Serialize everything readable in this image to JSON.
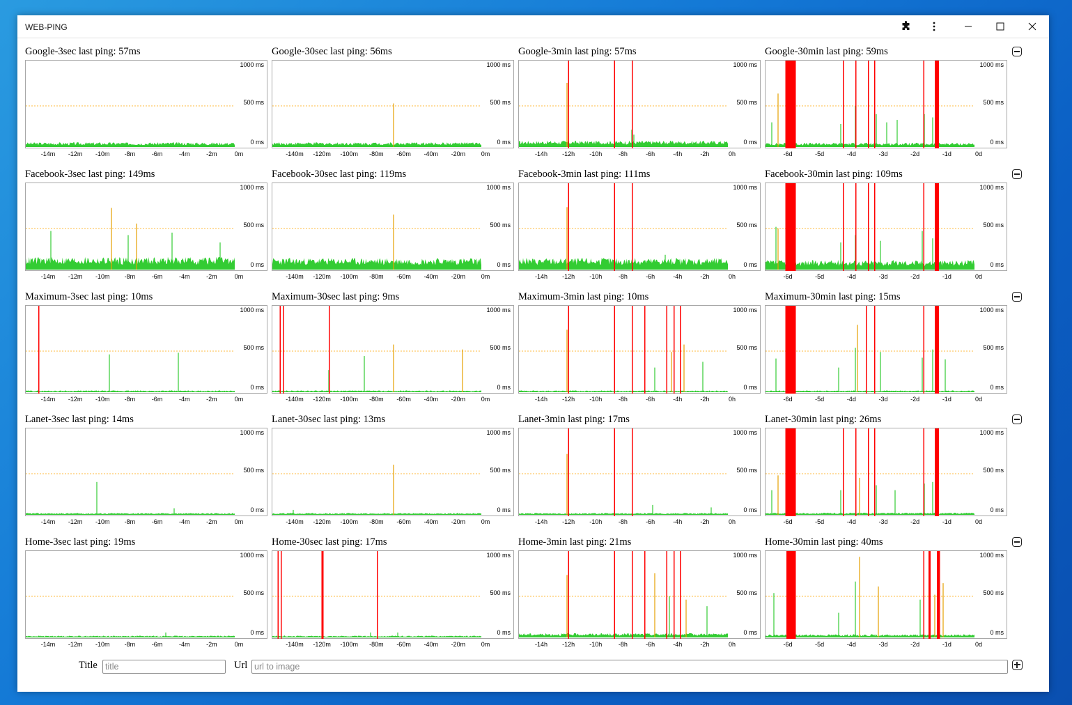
{
  "window": {
    "title": "WEB-PING",
    "controls": {
      "extensions_icon": "puzzle-icon",
      "menu_icon": "kebab-menu-icon",
      "minimize_icon": "minimize-icon",
      "maximize_icon": "maximize-icon",
      "close_icon": "close-icon"
    }
  },
  "colors": {
    "ok": "#33cc33",
    "warn": "#e6a000",
    "fail": "#ff0000",
    "threshold_line": "#ffa500"
  },
  "axis": {
    "y_labels": [
      "1000 ms",
      "500 ms",
      "0 ms"
    ],
    "y_range": [
      0,
      1000
    ],
    "threshold_ms": 500,
    "x_labels": {
      "3sec": [
        "-14m",
        "-12m",
        "-10m",
        "-8m",
        "-6m",
        "-4m",
        "-2m",
        "0m"
      ],
      "30sec": [
        "-140m",
        "-120m",
        "-100m",
        "-80m",
        "-60m",
        "-40m",
        "-20m",
        "0m"
      ],
      "3min": [
        "-14h",
        "-12h",
        "-10h",
        "-8h",
        "-6h",
        "-4h",
        "-2h",
        "0h"
      ],
      "30min": [
        "-6d",
        "-5d",
        "-4d",
        "-3d",
        "-2d",
        "-1d",
        "0d"
      ]
    }
  },
  "rows": [
    {
      "host": "Google",
      "charts": [
        {
          "interval": "3sec",
          "title": "Google-3sec last ping: 57ms"
        },
        {
          "interval": "30sec",
          "title": "Google-30sec last ping: 56ms"
        },
        {
          "interval": "3min",
          "title": "Google-3min last ping: 57ms"
        },
        {
          "interval": "30min",
          "title": "Google-30min last ping: 59ms"
        }
      ]
    },
    {
      "host": "Facebook",
      "charts": [
        {
          "interval": "3sec",
          "title": "Facebook-3sec last ping: 149ms"
        },
        {
          "interval": "30sec",
          "title": "Facebook-30sec last ping: 119ms"
        },
        {
          "interval": "3min",
          "title": "Facebook-3min last ping: 111ms"
        },
        {
          "interval": "30min",
          "title": "Facebook-30min last ping: 109ms"
        }
      ]
    },
    {
      "host": "Maximum",
      "charts": [
        {
          "interval": "3sec",
          "title": "Maximum-3sec last ping: 10ms"
        },
        {
          "interval": "30sec",
          "title": "Maximum-30sec last ping: 9ms"
        },
        {
          "interval": "3min",
          "title": "Maximum-3min last ping: 10ms"
        },
        {
          "interval": "30min",
          "title": "Maximum-30min last ping: 15ms"
        }
      ]
    },
    {
      "host": "Lanet",
      "charts": [
        {
          "interval": "3sec",
          "title": "Lanet-3sec last ping: 14ms"
        },
        {
          "interval": "30sec",
          "title": "Lanet-30sec last ping: 13ms"
        },
        {
          "interval": "3min",
          "title": "Lanet-3min last ping: 17ms"
        },
        {
          "interval": "30min",
          "title": "Lanet-30min last ping: 26ms"
        }
      ]
    },
    {
      "host": "Home",
      "charts": [
        {
          "interval": "3sec",
          "title": "Home-3sec last ping: 19ms"
        },
        {
          "interval": "30sec",
          "title": "Home-30sec last ping: 17ms"
        },
        {
          "interval": "3min",
          "title": "Home-3min last ping: 21ms"
        },
        {
          "interval": "30min",
          "title": "Home-30min last ping: 40ms"
        }
      ]
    }
  ],
  "chart_data": [
    {
      "type": "bar",
      "note_series": "per-chart ping history; base = typical ping ms, spikes = [position 0-1 along window, ms], fails = [start 0-1, end 0-1] timeouts",
      "charts": {
        "Google-3sec": {
          "base": 45,
          "spikes": [],
          "fails": []
        },
        "Google-30sec": {
          "base": 45,
          "spikes": [
            [
              0.58,
              530,
              "warn"
            ]
          ],
          "fails": []
        },
        "Google-3min": {
          "base": 60,
          "spikes": [
            [
              0.23,
              780,
              "warn"
            ],
            [
              0.54,
              210,
              "ok"
            ],
            [
              0.55,
              150,
              "ok"
            ],
            [
              0.63,
              40,
              "ok"
            ]
          ],
          "fails": [
            [
              0.235,
              0.24
            ],
            [
              0.455,
              0.46
            ],
            [
              0.54,
              0.545
            ]
          ]
        },
        "Google-30min": {
          "base": 40,
          "spikes": [
            [
              0.03,
              300,
              "ok"
            ],
            [
              0.06,
              650,
              "warn"
            ],
            [
              0.36,
              280,
              "ok"
            ],
            [
              0.43,
              500,
              "ok"
            ],
            [
              0.53,
              400,
              "ok"
            ],
            [
              0.58,
              300,
              "ok"
            ],
            [
              0.63,
              330,
              "ok"
            ],
            [
              0.76,
              400,
              "ok"
            ],
            [
              0.8,
              360,
              "ok"
            ]
          ],
          "fails": [
            [
              0.095,
              0.145
            ],
            [
              0.37,
              0.375
            ],
            [
              0.43,
              0.435
            ],
            [
              0.49,
              0.495
            ],
            [
              0.52,
              0.525
            ],
            [
              0.755,
              0.76
            ],
            [
              0.81,
              0.83
            ]
          ]
        },
        "Facebook-3sec": {
          "base": 120,
          "spikes": [
            [
              0.12,
              470,
              "ok"
            ],
            [
              0.41,
              750,
              "warn"
            ],
            [
              0.49,
              420,
              "ok"
            ],
            [
              0.53,
              560,
              "warn"
            ],
            [
              0.7,
              450,
              "ok"
            ],
            [
              0.93,
              330,
              "ok"
            ]
          ],
          "fails": []
        },
        "Facebook-30sec": {
          "base": 110,
          "spikes": [
            [
              0.58,
              670,
              "warn"
            ]
          ],
          "fails": []
        },
        "Facebook-3min": {
          "base": 110,
          "spikes": [
            [
              0.23,
              760,
              "warn"
            ],
            [
              0.7,
              180,
              "ok"
            ]
          ],
          "fails": [
            [
              0.235,
              0.24
            ],
            [
              0.455,
              0.46
            ],
            [
              0.54,
              0.545
            ]
          ]
        },
        "Facebook-30min": {
          "base": 90,
          "spikes": [
            [
              0.05,
              520,
              "ok"
            ],
            [
              0.06,
              500,
              "warn"
            ],
            [
              0.36,
              330,
              "ok"
            ],
            [
              0.43,
              420,
              "ok"
            ],
            [
              0.55,
              350,
              "ok"
            ],
            [
              0.75,
              470,
              "ok"
            ],
            [
              0.8,
              380,
              "ok"
            ]
          ],
          "fails": [
            [
              0.095,
              0.145
            ],
            [
              0.37,
              0.375
            ],
            [
              0.43,
              0.435
            ],
            [
              0.49,
              0.495
            ],
            [
              0.52,
              0.525
            ],
            [
              0.755,
              0.76
            ],
            [
              0.81,
              0.83
            ]
          ]
        },
        "Maximum-3sec": {
          "base": 8,
          "spikes": [
            [
              0.4,
              460,
              "ok"
            ],
            [
              0.73,
              480,
              "ok"
            ]
          ],
          "fails": [
            [
              0.06,
              0.065
            ]
          ]
        },
        "Maximum-30sec": {
          "base": 8,
          "spikes": [
            [
              0.27,
              270,
              "ok"
            ],
            [
              0.44,
              440,
              "ok"
            ],
            [
              0.58,
              580,
              "warn"
            ],
            [
              0.91,
              520,
              "warn"
            ]
          ],
          "fails": [
            [
              0.035,
              0.04
            ],
            [
              0.05,
              0.055
            ],
            [
              0.27,
              0.275
            ]
          ]
        },
        "Maximum-3min": {
          "base": 10,
          "spikes": [
            [
              0.23,
              760,
              "warn"
            ],
            [
              0.65,
              300,
              "ok"
            ],
            [
              0.73,
              490,
              "warn"
            ],
            [
              0.79,
              580,
              "warn"
            ],
            [
              0.88,
              370,
              "ok"
            ]
          ],
          "fails": [
            [
              0.235,
              0.24
            ],
            [
              0.455,
              0.46
            ],
            [
              0.54,
              0.545
            ],
            [
              0.6,
              0.605
            ],
            [
              0.705,
              0.71
            ],
            [
              0.74,
              0.745
            ],
            [
              0.77,
              0.775
            ]
          ]
        },
        "Maximum-30min": {
          "base": 12,
          "spikes": [
            [
              0.05,
              410,
              "ok"
            ],
            [
              0.35,
              300,
              "ok"
            ],
            [
              0.43,
              540,
              "ok"
            ],
            [
              0.44,
              820,
              "warn"
            ],
            [
              0.55,
              490,
              "ok"
            ],
            [
              0.75,
              420,
              "ok"
            ],
            [
              0.8,
              520,
              "ok"
            ],
            [
              0.86,
              400,
              "ok"
            ]
          ],
          "fails": [
            [
              0.095,
              0.145
            ],
            [
              0.48,
              0.485
            ],
            [
              0.52,
              0.525
            ],
            [
              0.755,
              0.76
            ],
            [
              0.81,
              0.83
            ]
          ]
        },
        "Lanet-3sec": {
          "base": 10,
          "spikes": [
            [
              0.34,
              400,
              "ok"
            ],
            [
              0.71,
              80,
              "ok"
            ]
          ],
          "fails": []
        },
        "Lanet-30sec": {
          "base": 12,
          "spikes": [
            [
              0.58,
              610,
              "warn"
            ],
            [
              0.1,
              60,
              "ok"
            ]
          ],
          "fails": []
        },
        "Lanet-3min": {
          "base": 14,
          "spikes": [
            [
              0.23,
              740,
              "warn"
            ],
            [
              0.64,
              120,
              "ok"
            ],
            [
              0.92,
              90,
              "ok"
            ]
          ],
          "fails": [
            [
              0.235,
              0.24
            ],
            [
              0.455,
              0.46
            ],
            [
              0.54,
              0.545
            ]
          ]
        },
        "Lanet-30min": {
          "base": 20,
          "spikes": [
            [
              0.03,
              300,
              "ok"
            ],
            [
              0.06,
              480,
              "warn"
            ],
            [
              0.36,
              300,
              "ok"
            ],
            [
              0.45,
              450,
              "warn"
            ],
            [
              0.53,
              360,
              "ok"
            ],
            [
              0.62,
              300,
              "ok"
            ],
            [
              0.76,
              380,
              "ok"
            ],
            [
              0.8,
              400,
              "ok"
            ]
          ],
          "fails": [
            [
              0.095,
              0.145
            ],
            [
              0.37,
              0.375
            ],
            [
              0.43,
              0.435
            ],
            [
              0.49,
              0.495
            ],
            [
              0.52,
              0.525
            ],
            [
              0.755,
              0.76
            ],
            [
              0.81,
              0.83
            ]
          ]
        },
        "Home-3sec": {
          "base": 15,
          "spikes": [
            [
              0.67,
              60,
              "ok"
            ]
          ],
          "fails": []
        },
        "Home-30sec": {
          "base": 15,
          "spikes": [
            [
              0.47,
              60,
              "ok"
            ],
            [
              0.6,
              60,
              "ok"
            ]
          ],
          "fails": [
            [
              0.025,
              0.03
            ],
            [
              0.04,
              0.045
            ],
            [
              0.235,
              0.245
            ],
            [
              0.5,
              0.505
            ]
          ]
        },
        "Home-3min": {
          "base": 40,
          "spikes": [
            [
              0.23,
              760,
              "warn"
            ],
            [
              0.65,
              780,
              "warn"
            ],
            [
              0.72,
              500,
              "ok"
            ],
            [
              0.8,
              460,
              "warn"
            ],
            [
              0.9,
              380,
              "ok"
            ]
          ],
          "fails": [
            [
              0.235,
              0.24
            ],
            [
              0.455,
              0.46
            ],
            [
              0.54,
              0.545
            ],
            [
              0.6,
              0.605
            ],
            [
              0.705,
              0.71
            ],
            [
              0.74,
              0.745
            ],
            [
              0.77,
              0.775
            ]
          ]
        },
        "Home-30min": {
          "base": 30,
          "spikes": [
            [
              0.04,
              540,
              "ok"
            ],
            [
              0.35,
              300,
              "ok"
            ],
            [
              0.43,
              680,
              "ok"
            ],
            [
              0.45,
              980,
              "warn"
            ],
            [
              0.54,
              620,
              "warn"
            ],
            [
              0.74,
              460,
              "ok"
            ],
            [
              0.81,
              520,
              "warn"
            ],
            [
              0.85,
              660,
              "warn"
            ]
          ],
          "fails": [
            [
              0.1,
              0.145
            ],
            [
              0.755,
              0.76
            ],
            [
              0.78,
              0.79
            ],
            [
              0.82,
              0.835
            ]
          ]
        }
      }
    }
  ],
  "form": {
    "title_label": "Title",
    "title_placeholder": "title",
    "url_label": "Url",
    "url_placeholder": "url to image"
  }
}
